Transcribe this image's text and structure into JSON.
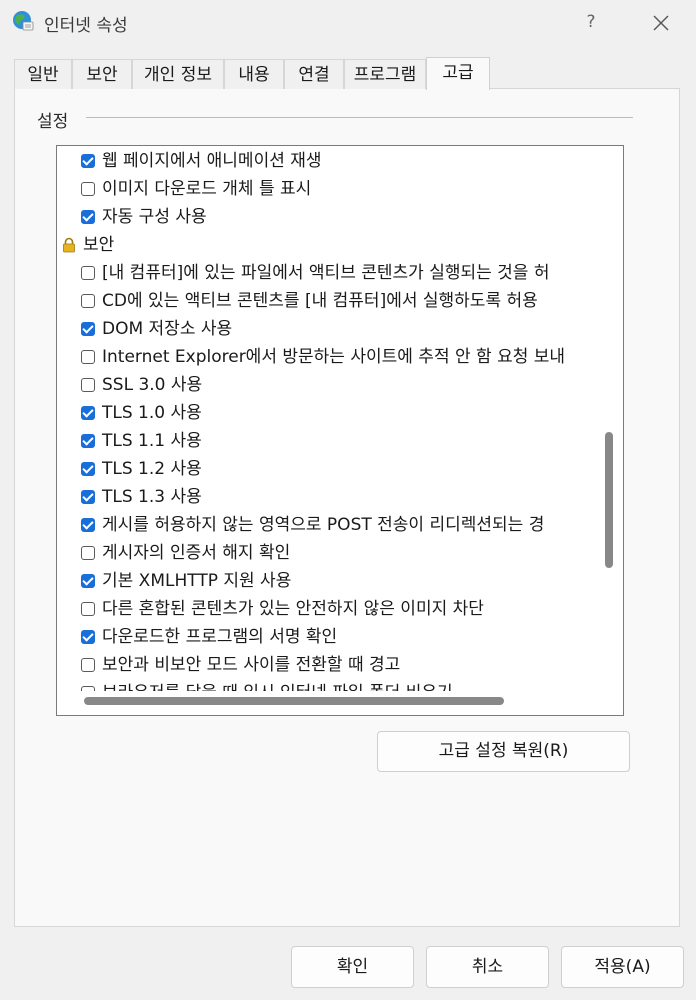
{
  "window": {
    "title": "인터넷 속성",
    "help_label": "?"
  },
  "tabs": [
    {
      "label": "일반",
      "active": false
    },
    {
      "label": "보안",
      "active": false
    },
    {
      "label": "개인 정보",
      "active": false
    },
    {
      "label": "내용",
      "active": false
    },
    {
      "label": "연결",
      "active": false
    },
    {
      "label": "프로그램",
      "active": false
    },
    {
      "label": "고급",
      "active": true
    }
  ],
  "settings": {
    "group_label": "설정",
    "items": [
      {
        "label": "웹 페이지에서 애니메이션 재생",
        "checked": true
      },
      {
        "label": "이미지 다운로드 개체 틀 표시",
        "checked": false
      },
      {
        "label": "자동 구성 사용",
        "checked": true
      },
      {
        "label": "보안",
        "category": true,
        "icon": "lock-icon"
      },
      {
        "label": "[내 컴퓨터]에 있는 파일에서 액티브 콘텐츠가 실행되는 것을 허",
        "checked": false
      },
      {
        "label": "CD에 있는 액티브 콘텐츠를 [내 컴퓨터]에서 실행하도록 허용",
        "checked": false
      },
      {
        "label": "DOM 저장소 사용",
        "checked": true
      },
      {
        "label": "Internet Explorer에서 방문하는 사이트에 추적 안 함 요청 보내",
        "checked": false
      },
      {
        "label": "SSL 3.0 사용",
        "checked": false
      },
      {
        "label": "TLS 1.0 사용",
        "checked": true
      },
      {
        "label": "TLS 1.1 사용",
        "checked": true
      },
      {
        "label": "TLS 1.2 사용",
        "checked": true
      },
      {
        "label": "TLS 1.3 사용",
        "checked": true
      },
      {
        "label": "게시를 허용하지 않는 영역으로 POST 전송이 리디렉션되는 경",
        "checked": true
      },
      {
        "label": "게시자의 인증서 해지 확인",
        "checked": false
      },
      {
        "label": "기본 XMLHTTP 지원 사용",
        "checked": true
      },
      {
        "label": "다른 혼합된 콘텐츠가 있는 안전하지 않은 이미지 차단",
        "checked": false
      },
      {
        "label": "다운로드한 프로그램의 서명 확인",
        "checked": true
      },
      {
        "label": "보안과 비보안 모드 사이를 전환할 때 경고",
        "checked": false
      },
      {
        "label": "브라우저를 닫을 때 임시 인터넷 파일 폴더 비우기",
        "checked": false
      }
    ]
  },
  "buttons": {
    "restore": "고급 설정 복원(R)",
    "ok": "확인",
    "cancel": "취소",
    "apply": "적용(A)"
  },
  "colors": {
    "accent": "#1a6ed8",
    "window_bg": "#f0f0f0"
  }
}
